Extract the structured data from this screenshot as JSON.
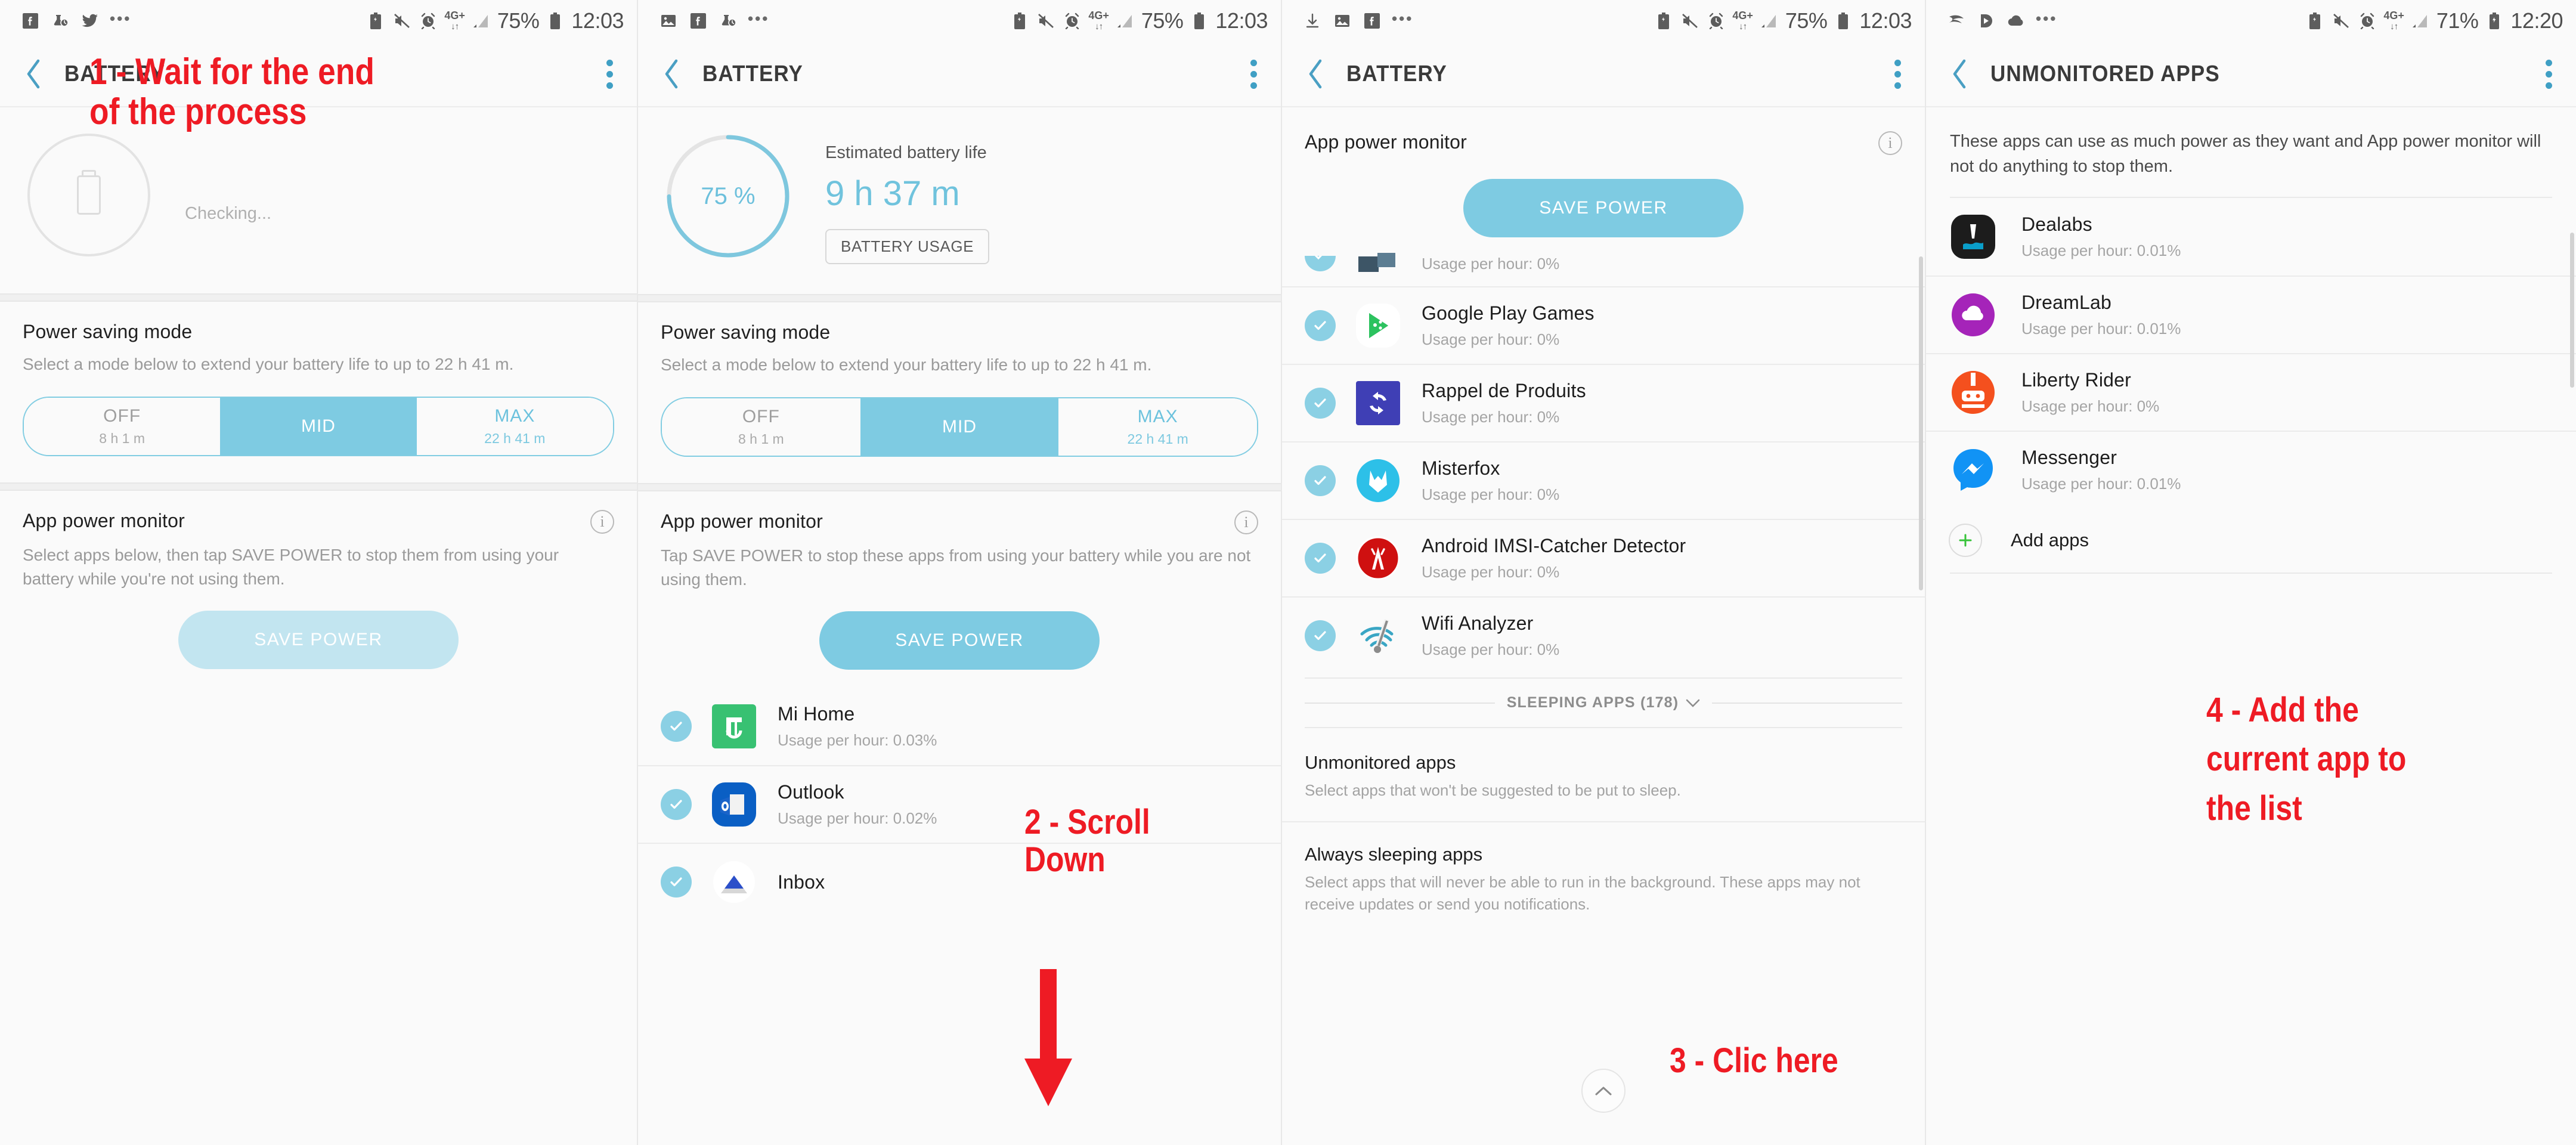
{
  "panels": [
    {
      "status": {
        "time": "12:03",
        "battery_pct": "75%",
        "network": "4G+",
        "left_icons": [
          "facebook-icon",
          "flask-clock-icon",
          "twitter-icon",
          "overflow-dots-icon"
        ]
      },
      "appbar": {
        "title": "BATTERY"
      },
      "checking": {
        "label": "Checking..."
      },
      "power_saving": {
        "title": "Power saving mode",
        "desc": "Select a mode below to extend your battery life to up to 22 h 41 m.",
        "modes": [
          {
            "name": "OFF",
            "sub": "8 h 1 m",
            "selected": false
          },
          {
            "name": "MID",
            "sub": "",
            "selected": true
          },
          {
            "name": "MAX",
            "sub": "22 h 41 m",
            "selected": false
          }
        ]
      },
      "app_power_monitor": {
        "title": "App power monitor",
        "desc": "Select apps below, then tap SAVE POWER to stop them from using your battery while you're not using them.",
        "save_button": "SAVE POWER"
      },
      "annotation": "1 - Wait for the end\nof the process"
    },
    {
      "status": {
        "time": "12:03",
        "battery_pct": "75%",
        "network": "4G+",
        "left_icons": [
          "photo-icon",
          "facebook-icon",
          "flask-clock-icon",
          "overflow-dots-icon"
        ]
      },
      "appbar": {
        "title": "BATTERY"
      },
      "battery": {
        "percent": "75 %",
        "percent_value": 75,
        "estimated_label": "Estimated battery life",
        "estimated_value": "9 h 37 m",
        "usage_button": "BATTERY USAGE"
      },
      "power_saving": {
        "title": "Power saving mode",
        "desc": "Select a mode below to extend your battery life to up to 22 h 41 m.",
        "modes": [
          {
            "name": "OFF",
            "sub": "8 h 1 m",
            "selected": false
          },
          {
            "name": "MID",
            "sub": "",
            "selected": true
          },
          {
            "name": "MAX",
            "sub": "22 h 41 m",
            "selected": false
          }
        ]
      },
      "app_power_monitor": {
        "title": "App power monitor",
        "desc": "Tap SAVE POWER to stop these apps from using your battery while you are not using them.",
        "save_button": "SAVE POWER"
      },
      "apps": [
        {
          "name": "Mi Home",
          "usage": "Usage per hour: 0.03%",
          "icon": "mi-home-icon",
          "checked": true
        },
        {
          "name": "Outlook",
          "usage": "Usage per hour: 0.02%",
          "icon": "outlook-icon",
          "checked": true
        },
        {
          "name": "Inbox",
          "usage": "",
          "icon": "inbox-icon",
          "checked": true
        }
      ],
      "annotation": "2 - Scroll\nDown"
    },
    {
      "status": {
        "time": "12:03",
        "battery_pct": "75%",
        "network": "4G+",
        "left_icons": [
          "download-icon",
          "photo-icon",
          "facebook-icon",
          "overflow-dots-icon"
        ]
      },
      "appbar": {
        "title": "BATTERY"
      },
      "app_power_monitor": {
        "title": "App power monitor",
        "save_button": "SAVE POWER"
      },
      "apps": [
        {
          "name": "",
          "usage": "Usage per hour: 0%",
          "icon": "teams-icon",
          "checked": true
        },
        {
          "name": "Google Play Games",
          "usage": "Usage per hour: 0%",
          "icon": "play-games-icon",
          "checked": true
        },
        {
          "name": "Rappel de Produits",
          "usage": "Usage per hour: 0%",
          "icon": "rappel-icon",
          "checked": true
        },
        {
          "name": "Misterfox",
          "usage": "Usage per hour: 0%",
          "icon": "misterfox-icon",
          "checked": true
        },
        {
          "name": "Android IMSI-Catcher Detector",
          "usage": "Usage per hour: 0%",
          "icon": "imsi-icon",
          "checked": true
        },
        {
          "name": "Wifi Analyzer",
          "usage": "Usage per hour: 0%",
          "icon": "wifi-analyzer-icon",
          "checked": true
        }
      ],
      "sleeping_band": "SLEEPING APPS (178)",
      "sections": [
        {
          "title": "Unmonitored apps",
          "desc": "Select apps that won't be suggested to be put to sleep."
        },
        {
          "title": "Always sleeping apps",
          "desc": "Select apps that will never be able to run in the background. These apps may not receive updates or send you notifications."
        }
      ],
      "annotation": "3 - Clic here"
    },
    {
      "status": {
        "time": "12:20",
        "battery_pct": "71%",
        "network": "4G+",
        "left_icons": [
          "swoosh-icon",
          "play-icon",
          "cloud-icon",
          "overflow-dots-icon"
        ]
      },
      "appbar": {
        "title": "UNMONITORED APPS"
      },
      "intro": "These apps can use as much power as they want and App power monitor will not do anything to stop them.",
      "apps": [
        {
          "name": "Dealabs",
          "usage": "Usage per hour: 0.01%",
          "icon": "dealabs-icon"
        },
        {
          "name": "DreamLab",
          "usage": "Usage per hour: 0.01%",
          "icon": "dreamlab-icon"
        },
        {
          "name": "Liberty Rider",
          "usage": "Usage per hour: 0%",
          "icon": "liberty-rider-icon"
        },
        {
          "name": "Messenger",
          "usage": "Usage per hour: 0.01%",
          "icon": "messenger-icon"
        }
      ],
      "add_apps": "Add apps",
      "annotation": "4 - Add the\ncurrent app to\nthe list"
    }
  ],
  "colors": {
    "accent": "#7ecbe2",
    "annotation_red": "#ee1b24",
    "text_primary": "#1d1d1d",
    "text_muted": "#a3a3a3"
  }
}
